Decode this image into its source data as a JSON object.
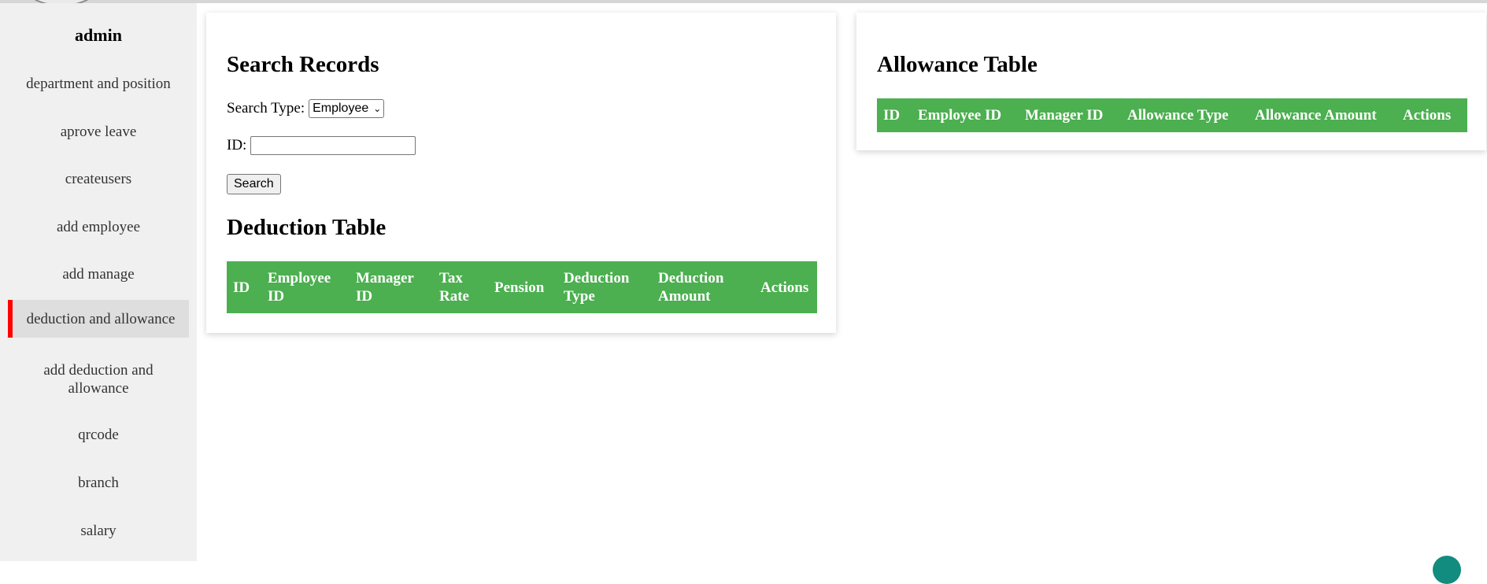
{
  "sidebar": {
    "user": "admin",
    "items": [
      {
        "label": "department and position"
      },
      {
        "label": "aprove leave"
      },
      {
        "label": "createusers"
      },
      {
        "label": "add employee"
      },
      {
        "label": "add manage"
      },
      {
        "label": "deduction and allowance",
        "active": true
      },
      {
        "label": "add deduction and allowance"
      },
      {
        "label": "qrcode"
      },
      {
        "label": "branch"
      },
      {
        "label": "salary"
      }
    ],
    "active_color": "#ff0000"
  },
  "search": {
    "title": "Search Records",
    "type_label": "Search Type:",
    "type_value": "Employee",
    "id_label": "ID:",
    "id_value": "",
    "button_label": "Search"
  },
  "deduction_table": {
    "title": "Deduction Table",
    "headers": [
      "ID",
      "Employee ID",
      "Manager ID",
      "Tax Rate",
      "Pension",
      "Deduction Type",
      "Deduction Amount",
      "Actions"
    ],
    "rows": []
  },
  "allowance_table": {
    "title": "Allowance Table",
    "headers": [
      "ID",
      "Employee ID",
      "Manager ID",
      "Allowance Type",
      "Allowance Amount",
      "Actions"
    ],
    "rows": []
  },
  "colors": {
    "table_header": "#4caf50",
    "sidebar_bg": "#f0f0f0"
  }
}
